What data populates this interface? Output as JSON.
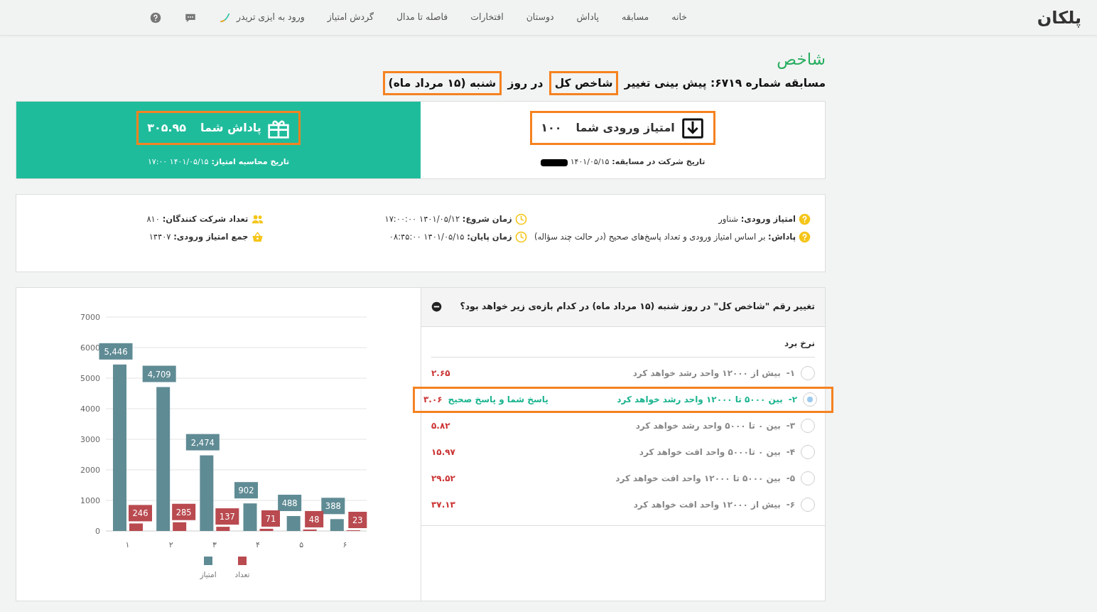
{
  "navbar": {
    "logo": "پلکان",
    "items": [
      {
        "label": "خانه"
      },
      {
        "label": "مسابقه"
      },
      {
        "label": "پاداش"
      },
      {
        "label": "دوستان"
      },
      {
        "label": "افتخارات"
      },
      {
        "label": "فاصله تا مدال"
      },
      {
        "label": "گردش امتیاز"
      },
      {
        "label": "ورود به ایزی تریدر",
        "kind": "trader"
      },
      {
        "kind": "chat"
      },
      {
        "kind": "help"
      }
    ]
  },
  "heading": {
    "category": "شاخص",
    "title_parts": [
      {
        "text": "مسابقه شماره ۶۷۱۹: پیش بینی تغییر ",
        "highlighted": false
      },
      {
        "text": "شاخص کل",
        "highlighted": true
      },
      {
        "text": " در روز ",
        "highlighted": false
      },
      {
        "text": "شنبه (۱۵ مرداد ماه)",
        "highlighted": true
      }
    ]
  },
  "entry_card": {
    "label": "امتیاز ورودی شما",
    "value": "۱۰۰",
    "highlighted": true,
    "date_label": "تاریخ شرکت در مسابقه:",
    "date": "۱۴۰۱/۰۵/۱۵",
    "redacted": true
  },
  "reward_card": {
    "label": "پاداش شما",
    "value": "۳۰۵.۹۵",
    "highlighted": true,
    "date_label": "تاریخ محاسبه امتیاز:",
    "date": "۱۴۰۱/۰۵/۱۵ ۱۷:۰۰"
  },
  "info": {
    "columns": [
      [
        {
          "kind": "help",
          "text": "**امتیاز ورودی:** شناور"
        },
        {
          "kind": "help",
          "text": "**پاداش:** بر اساس امتیاز ورودی و تعداد پاسخ‌های صحیح (در حالت چند سؤاله)"
        }
      ],
      [
        {
          "kind": "clock",
          "text": "**زمان شروع:** ۱۴۰۱/۰۵/۱۲ ۱۷:۰۰:۰۰"
        },
        {
          "kind": "clock",
          "text": "**زمان پایان:** ۱۴۰۱/۰۵/۱۵ ۰۸:۴۵:۰۰"
        }
      ],
      [
        {
          "kind": "people",
          "text": "**تعداد شرکت کنندگان:** ۸۱۰"
        },
        {
          "kind": "basket",
          "text": "**جمع امتیاز ورودی:** ۱۴۴۰۷"
        }
      ]
    ]
  },
  "question": {
    "text": "تغییر رقم \"شاخص کل\" در روز شنبه (۱۵ مرداد ماه) در کدام بازه‌ی زیر خواهد بود؟",
    "expanded": true,
    "rate_header": "نرخ برد",
    "options": [
      {
        "number": "۱-",
        "text": "بیش از ۱۲۰۰۰ واحد رشد خواهد کرد",
        "rate": "۲.۶۵",
        "selected": false,
        "highlighted": false
      },
      {
        "number": "۲-",
        "text": "بین ۵۰۰۰ تا ۱۲۰۰۰ واحد رشد خواهد کرد",
        "rate": "۳.۰۶",
        "selected": true,
        "highlighted": true,
        "status": "پاسخ شما و پاسخ صحیح"
      },
      {
        "number": "۳-",
        "text": "بین ۰ تا ۵۰۰۰ واحد رشد خواهد کرد",
        "rate": "۵.۸۲",
        "selected": false,
        "highlighted": false
      },
      {
        "number": "۴-",
        "text": "بین ۰ تا۵۰۰۰ واحد افت خواهد کرد",
        "rate": "۱۵.۹۷",
        "selected": false,
        "highlighted": false
      },
      {
        "number": "۵-",
        "text": "بین ۵۰۰۰ تا ۱۲۰۰۰ واحد افت خواهد کرد",
        "rate": "۲۹.۵۲",
        "selected": false,
        "highlighted": false
      },
      {
        "number": "۶-",
        "text": "بیش از ۱۲۰۰۰ واحد افت خواهد کرد",
        "rate": "۳۷.۱۳",
        "selected": false,
        "highlighted": false
      }
    ]
  },
  "chart": {
    "chart_data": {
      "type": "bar",
      "categories": [
        "۱",
        "۲",
        "۳",
        "۴",
        "۵",
        "۶"
      ],
      "ylim": [
        0,
        7000
      ],
      "yticks": [
        0,
        1000,
        2000,
        3000,
        4000,
        5000,
        6000,
        7000
      ],
      "grid": true,
      "legend": true,
      "series": [
        {
          "name": "امتیاز",
          "color": "#5f8b94",
          "values": [
            5446,
            4709,
            2474,
            902,
            488,
            388
          ],
          "value_labels": [
            "5,446",
            "4,709",
            "2,474",
            "902",
            "488",
            "388"
          ]
        },
        {
          "name": "تعداد",
          "color": "#b94a50",
          "values": [
            246,
            285,
            137,
            71,
            48,
            23
          ],
          "value_labels": [
            "246",
            "285",
            "137",
            "71",
            "48",
            "23"
          ]
        }
      ]
    }
  }
}
